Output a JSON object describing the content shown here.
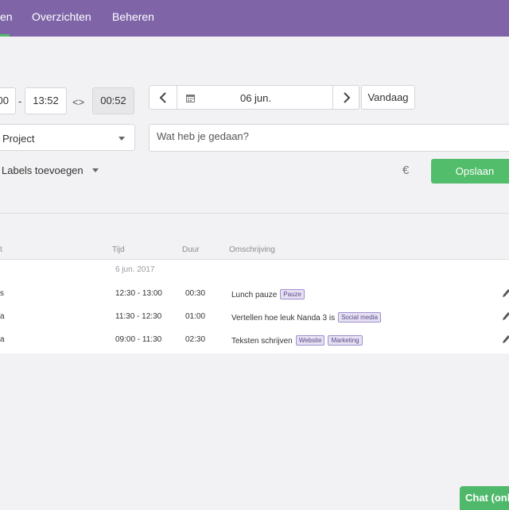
{
  "nav": {
    "items": [
      {
        "label": "en"
      },
      {
        "label": "Overzichten"
      },
      {
        "label": "Beheren"
      }
    ]
  },
  "form": {
    "start_time": "00",
    "separator": "-",
    "end_time": "13:52",
    "swap_symbol": "<>",
    "duration": "00:52",
    "date": "06 jun.",
    "today_label": "Vandaag",
    "project_label": "Project",
    "description_placeholder": "Wat heb je gedaan?",
    "labels_label": "Labels toevoegen",
    "currency_symbol": "€",
    "save_label": "Opslaan"
  },
  "table": {
    "headers": {
      "first": "t",
      "time": "Tijd",
      "duration": "Duur",
      "description": "Omschrijving"
    },
    "date_group": "6 jun. 2017",
    "rows": [
      {
        "first": "s",
        "time": "12:30 - 13:00",
        "duration": "00:30",
        "description": "Lunch pauze",
        "tags": [
          "Pauze"
        ]
      },
      {
        "first": "a",
        "time": "11:30 - 12:30",
        "duration": "01:00",
        "description": "Vertellen hoe leuk Nanda 3 is",
        "tags": [
          "Social media"
        ]
      },
      {
        "first": "a",
        "time": "09:00 - 11:30",
        "duration": "02:30",
        "description": "Teksten schrijven",
        "tags": [
          "Website",
          "Marketing"
        ]
      }
    ]
  },
  "chat": {
    "label": "Chat (onli"
  },
  "colors": {
    "nav": "#7f65a8",
    "accent_green": "#52bd6b",
    "tag_bg": "#e6e0f3"
  },
  "icons": [
    "chevron-left-icon",
    "calendar-icon",
    "chevron-right-icon",
    "caret-down-icon",
    "pencil-icon"
  ]
}
